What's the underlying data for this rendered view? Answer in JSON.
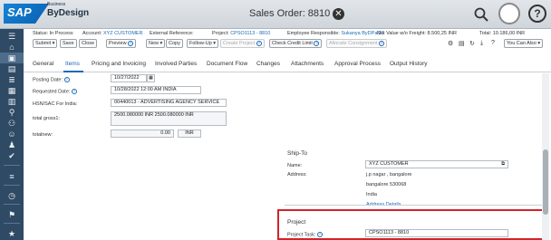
{
  "app": {
    "logo_sap": "SAP",
    "logo_business": "Business",
    "logo_bydesign": "ByDesign",
    "title": "Sales Order: 8810"
  },
  "header": {
    "status_label": "Status:",
    "status_value": "In Process",
    "account_label": "Account:",
    "account_value": "XYZ CUSTOMER",
    "extref_label": "External Reference:",
    "extref_value": "",
    "project_label": "Project:",
    "project_value": "CPSO1113 - 8810",
    "employee_label": "Employee Responsible:",
    "employee_value": "Sukanya ByDPal21",
    "netvalue_label": "Net Value w/o Freight:",
    "netvalue_value": "8.500,25 INR",
    "total_label": "Total:",
    "total_value": "10.186,00 INR"
  },
  "toolbar": {
    "submit": "Submit",
    "save": "Save",
    "close": "Close",
    "preview": "Preview",
    "new": "New",
    "copy": "Copy",
    "followup": "Follow-Up",
    "create_project": "Create Project",
    "check_credit": "Check Credit Limit",
    "allocate": "Allocate Consignment",
    "you_can_also": "You Can Also"
  },
  "tabs": [
    "General",
    "Items",
    "Pricing and Invoicing",
    "Involved Parties",
    "Document Flow",
    "Changes",
    "Attachments",
    "Approval Process",
    "Output History"
  ],
  "form": {
    "posting_date_label": "Posting Date:",
    "posting_date_value": "10/27/2022",
    "requested_date_label": "Requested Date:",
    "requested_date_value": "10/28/2022 12:00 AM INDIA",
    "hsn_label": "HSN/SAC For India:",
    "hsn_value": "00440013 - ADVERTISING AGENCY SERVICE",
    "total_gross_label": "total gross1:",
    "total_gross_value": "2500.080000 INR 2500.080000 INR",
    "totalnew_label": "totalnew:",
    "totalnew_value": "0.00",
    "totalnew_currency": "INR"
  },
  "shipto": {
    "heading": "Ship-To",
    "name_label": "Name:",
    "name_value": "XYZ CUSTOMER",
    "address_label": "Address:",
    "address_line1": "j.p nagar , bangalore",
    "address_line2": "bangalore 530068",
    "address_line3": "India",
    "address_details": "Address Details"
  },
  "project": {
    "heading": "Project",
    "task_label": "Project Task:",
    "task_value": "CPSO1113 - 8810"
  },
  "colors": {
    "accent": "#1a69b8",
    "highlight": "#d2232a",
    "sidebar": "#2f4a64"
  }
}
